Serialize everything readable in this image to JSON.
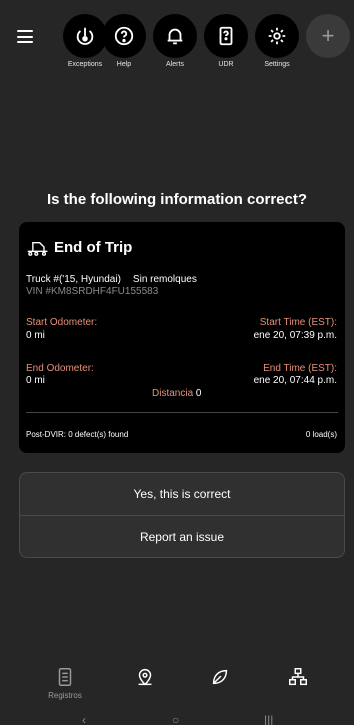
{
  "toolbar": {
    "menu_icon": "hamburger-menu-icon",
    "items": [
      {
        "label": "Exceptions",
        "icon": "exceptions-icon"
      },
      {
        "label": "Help",
        "icon": "help-icon"
      },
      {
        "label": "Alerts",
        "icon": "bell-icon"
      },
      {
        "label": "UDR",
        "icon": "udr-icon"
      },
      {
        "label": "Settings",
        "icon": "gear-icon"
      }
    ],
    "add_icon": "plus-icon",
    "add_label": "+"
  },
  "question": "Is the following information correct?",
  "trip": {
    "title": "End of Trip",
    "icon": "truck-icon",
    "truck": "Truck #('15, Hyundai)",
    "trailer": "Sin remolques",
    "vin": "VIN #KM8SRDHF4FU155583",
    "start_odometer_label": "Start Odometer:",
    "start_odometer_value": "0 mi",
    "start_time_label": "Start Time (EST):",
    "start_time_value": "ene 20, 07:39 p.m.",
    "end_odometer_label": "End Odometer:",
    "end_odometer_value": "0 mi",
    "end_time_label": "End Time (EST):",
    "end_time_value": "ene 20, 07:44 p.m.",
    "distance_label": "Distancia",
    "distance_value": "0",
    "dvir": "Post-DVIR: 0 defect(s) found",
    "loads": "0 load(s)"
  },
  "actions": {
    "confirm": "Yes, this is correct",
    "report": "Report an issue"
  },
  "bottom_nav": {
    "logs_label": "Registros",
    "logs_icon": "logs-icon",
    "location_icon": "location-pin-icon",
    "leaf_icon": "leaf-icon",
    "network_icon": "network-icon"
  },
  "system_nav": {
    "back": "‹",
    "home": "○",
    "recents": "|||"
  },
  "colors": {
    "background": "#262626",
    "card": "#000000",
    "accent_label": "#e8907a",
    "muted": "#8a8a8a"
  }
}
